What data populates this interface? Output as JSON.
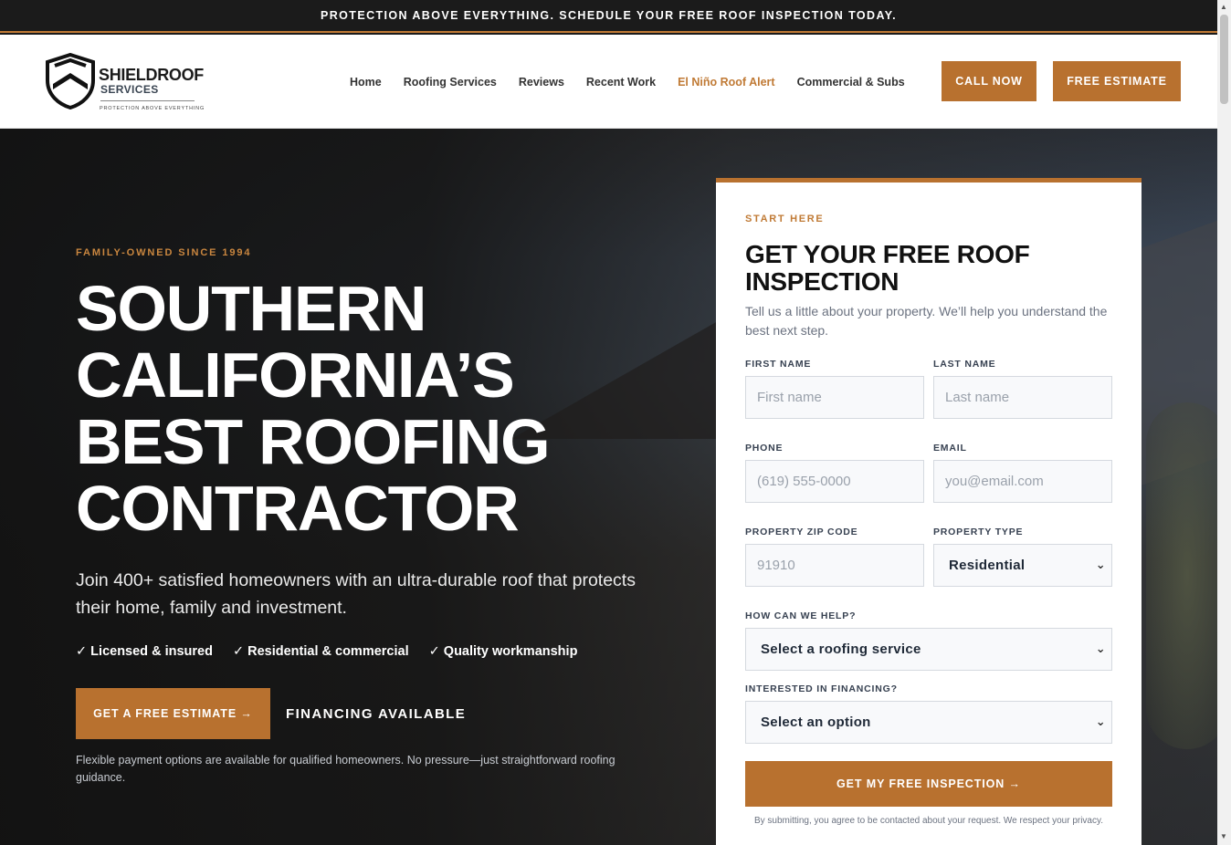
{
  "announcement": "PROTECTION ABOVE EVERYTHING. SCHEDULE YOUR FREE ROOF INSPECTION TODAY.",
  "logo": {
    "word1": "SHIELDROOF",
    "word2": "SERVICES",
    "tagline": "PROTECTION ABOVE EVERYTHING"
  },
  "nav": {
    "items": [
      "Home",
      "Roofing Services",
      "Reviews",
      "Recent Work",
      "El Niño Roof Alert",
      "Commercial & Subs"
    ]
  },
  "header_buttons": {
    "call": "CALL NOW",
    "estimate": "FREE ESTIMATE"
  },
  "hero": {
    "kicker": "FAMILY-OWNED SINCE 1994",
    "title": "SOUTHERN CALIFORNIA’S BEST ROOFING CONTRACTOR",
    "subtitle": "Join 400+ satisfied homeowners with an ultra-durable roof that protects their home, family and investment.",
    "checks": [
      "✓ Licensed & insured",
      "✓ Residential & commercial",
      "✓ Quality workmanship"
    ],
    "cta": "GET A FREE ESTIMATE →",
    "financing": "FINANCING AVAILABLE",
    "fineprint": "Flexible payment options are available for qualified homeowners. No pressure—just straightforward roofing guidance."
  },
  "form": {
    "kicker": "START HERE",
    "title": "GET YOUR FREE ROOF INSPECTION",
    "description": "Tell us a little about your property. We’ll help you understand the best next step.",
    "first_name": {
      "label": "FIRST NAME",
      "placeholder": "First name"
    },
    "last_name": {
      "label": "LAST NAME",
      "placeholder": "Last name"
    },
    "phone": {
      "label": "PHONE",
      "placeholder": "(619) 555-0000"
    },
    "email": {
      "label": "EMAIL",
      "placeholder": "you@email.com"
    },
    "zip": {
      "label": "PROPERTY ZIP CODE",
      "placeholder": "91910"
    },
    "property_type": {
      "label": "PROPERTY TYPE",
      "value": "Residential"
    },
    "help": {
      "label": "HOW CAN WE HELP?",
      "value": "Select a roofing service"
    },
    "financing": {
      "label": "INTERESTED IN FINANCING?",
      "value": "Select an option"
    },
    "submit": "GET MY FREE INSPECTION →",
    "privacy": "By submitting, you agree to be contacted about your request. We respect your privacy."
  },
  "icons": {
    "logo": "shield-icon",
    "select_arrow": "chevron-down-icon"
  },
  "colors": {
    "accent": "#b8712f",
    "topbar": "#1b1b1b"
  }
}
